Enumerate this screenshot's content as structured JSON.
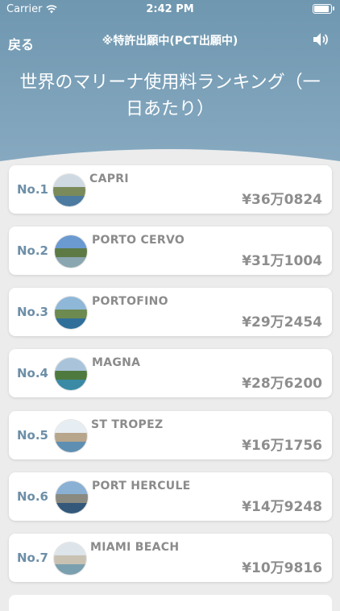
{
  "status_bar": {
    "carrier": "Carrier",
    "time": "2:42 PM"
  },
  "nav": {
    "back_label": "戻る",
    "notice": "※特許出願中(PCT出願中)",
    "sound_icon": "speaker-icon"
  },
  "page": {
    "title": "世界のマリーナ使用料ランキング（一日あたり）"
  },
  "colors": {
    "header": "#7a9fb8",
    "rank_text": "#6d8fa8",
    "price_text": "#8d8d8d"
  },
  "ranking": [
    {
      "rank": "No.1",
      "name": "CAPRI",
      "price": "¥36万0824",
      "thumb": {
        "sky": "#cfd9e2",
        "land": "#7a8a5a",
        "sea": "#4c7aa0"
      }
    },
    {
      "rank": "No.2",
      "name": "PORTO CERVO",
      "price": "¥31万1004",
      "thumb": {
        "sky": "#6a9ad0",
        "land": "#5d7a45",
        "sea": "#8aa6b0"
      }
    },
    {
      "rank": "No.3",
      "name": "PORTOFINO",
      "price": "¥29万2454",
      "thumb": {
        "sky": "#8fb7d8",
        "land": "#6d8a50",
        "sea": "#2f6f9a"
      }
    },
    {
      "rank": "No.4",
      "name": "MAGNA",
      "price": "¥28万6200",
      "thumb": {
        "sky": "#a9c4da",
        "land": "#4f7a3f",
        "sea": "#3a8aa6"
      }
    },
    {
      "rank": "No.5",
      "name": "ST TROPEZ",
      "price": "¥16万1756",
      "thumb": {
        "sky": "#e6eef3",
        "land": "#b7a58c",
        "sea": "#5e8fb2"
      }
    },
    {
      "rank": "No.6",
      "name": "PORT HERCULE",
      "price": "¥14万9248",
      "thumb": {
        "sky": "#8ab0d4",
        "land": "#8a8a80",
        "sea": "#33587a"
      }
    },
    {
      "rank": "No.7",
      "name": "MIAMI BEACH",
      "price": "¥10万9816",
      "thumb": {
        "sky": "#dde4ea",
        "land": "#c9c2b2",
        "sea": "#7aa0b0"
      }
    }
  ]
}
